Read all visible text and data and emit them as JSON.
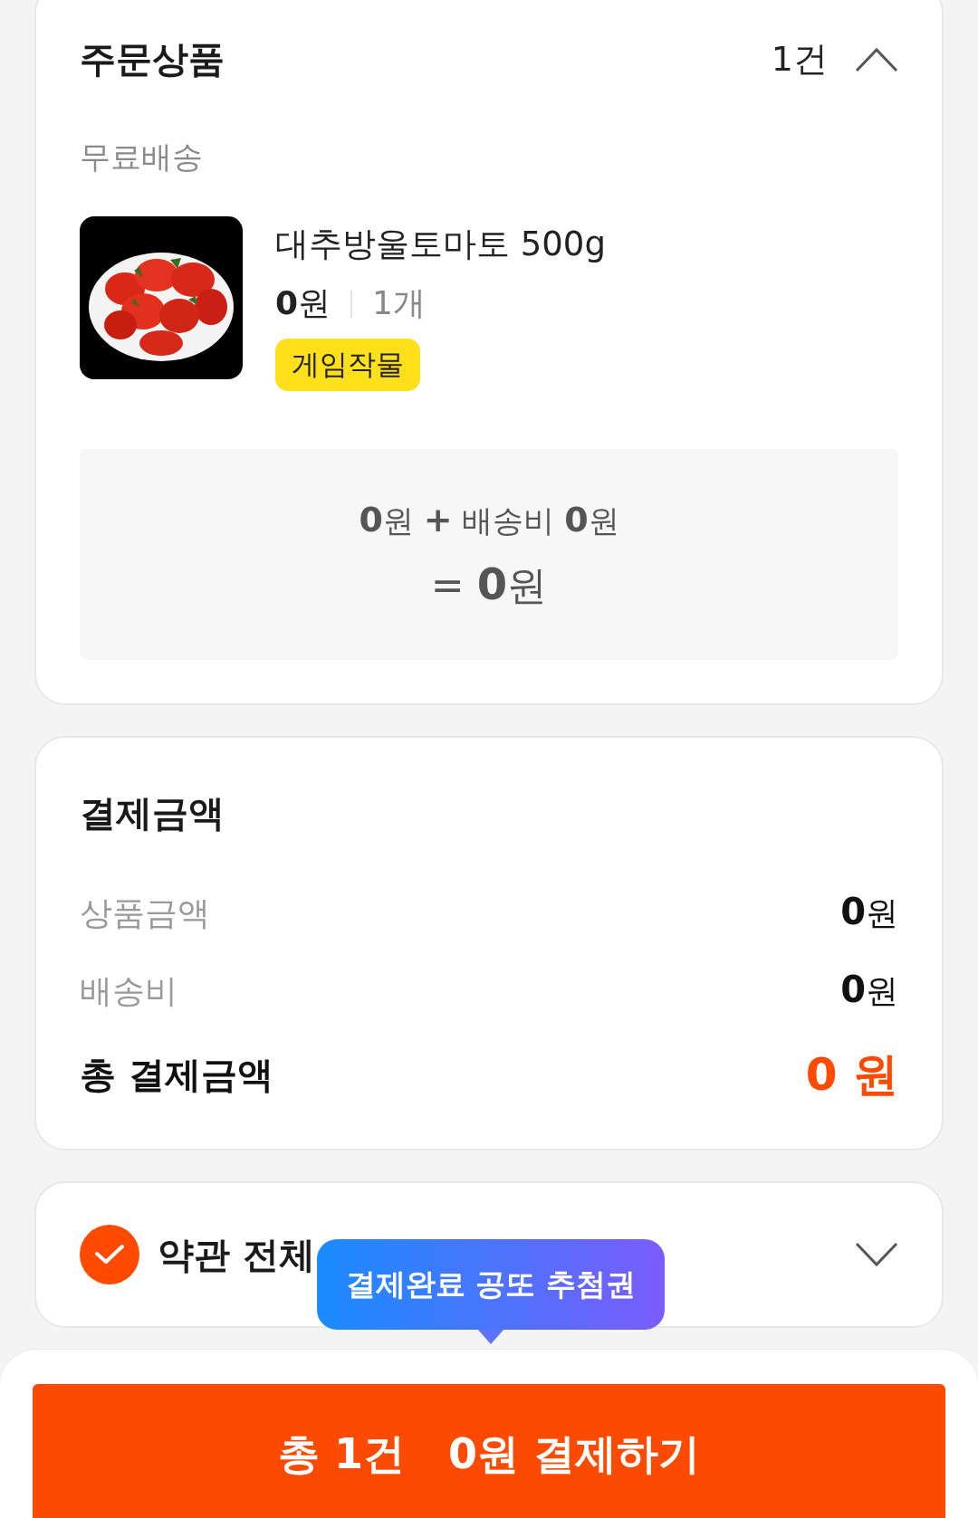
{
  "order_items": {
    "title": "주문상품",
    "count": "1건",
    "expanded": true,
    "shipping_group": "무료배송",
    "items": [
      {
        "kind": "picture",
        "name": "대추방울토마토 500g",
        "price": "**0**원",
        "quantity": "1개",
        "tag": "게임작물"
      }
    ],
    "summary": {
      "line_1": "**0**원 **+** 배송비 **0**원",
      "line_2": "= **0**원"
    }
  },
  "payment": {
    "title": "결제금액",
    "rows": [
      {
        "label": "상품금액",
        "value": "**0**원"
      },
      {
        "label": "배송비",
        "value": "**0**원"
      }
    ],
    "total": {
      "label": "총 결제금액",
      "value": "0 원"
    }
  },
  "terms": {
    "checked": true,
    "label": "약관 전체",
    "expanded": false,
    "tooltip": "결제완료 공또 추첨권"
  },
  "pay_button": {
    "count": "총 1건",
    "label": "0원 결제하기"
  }
}
